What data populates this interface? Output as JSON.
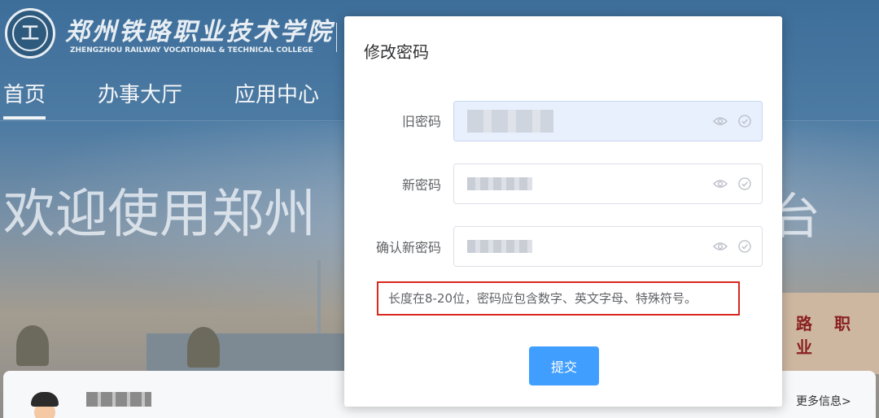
{
  "background": {
    "school_name_cn": "郑州铁路职业技术学院",
    "school_name_en": "ZHENGZHOU RAILWAY VOCATIONAL & TECHNICAL COLLEGE",
    "logo_text": "工",
    "nav": [
      {
        "label": "首页",
        "active": true
      },
      {
        "label": "办事大厅",
        "active": false
      },
      {
        "label": "应用中心",
        "active": false
      }
    ],
    "hero_text": "欢迎使用郑州",
    "hero_tail": "台",
    "gate_text": "路 职 业",
    "more_info": "更多信息>"
  },
  "dialog": {
    "title": "修改密码",
    "fields": [
      {
        "label": "旧密码",
        "placeholder": "",
        "autofilled": true
      },
      {
        "label": "新密码",
        "placeholder": "",
        "autofilled": false
      },
      {
        "label": "确认新密码",
        "placeholder": "",
        "autofilled": false
      }
    ],
    "hint": "长度在8-20位，密码应包含数字、英文字母、特殊符号。",
    "submit_label": "提交"
  },
  "colors": {
    "primary": "#409eff",
    "hint_border": "#d9281f",
    "autofill_bg": "#e8f0fe"
  },
  "icons": {
    "eye": "eye-icon",
    "check": "check-circle-icon"
  }
}
